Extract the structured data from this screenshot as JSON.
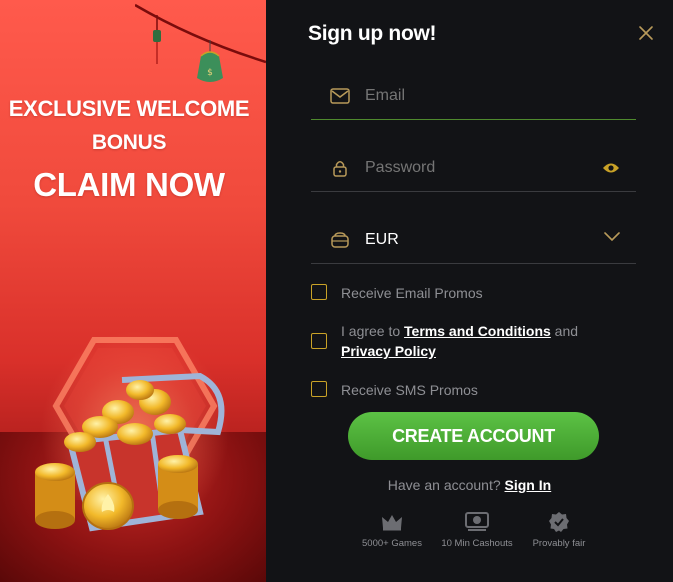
{
  "promo": {
    "line1": "EXCLUSIVE WELCOME",
    "line2": "BONUS",
    "line3": "CLAIM NOW"
  },
  "form": {
    "title": "Sign up now!",
    "email_placeholder": "Email",
    "password_placeholder": "Password",
    "currency_value": "EUR",
    "checkboxes": {
      "email_promos": "Receive Email Promos",
      "agree_prefix": "I agree to ",
      "terms_link": "Terms and Conditions",
      "agree_and": " and ",
      "privacy_link": "Privacy Policy",
      "sms_promos": "Receive SMS Promos"
    },
    "submit_label": "CREATE ACCOUNT",
    "have_account_text": "Have an account? ",
    "sign_in_link": "Sign In"
  },
  "features": [
    {
      "label": "5000+ Games",
      "icon": "crown-icon"
    },
    {
      "label": "10 Min Cashouts",
      "icon": "cashout-icon"
    },
    {
      "label": "Provably fair",
      "icon": "verified-badge-icon"
    }
  ],
  "colors": {
    "accent_green": "#4caf37",
    "checkbox_gold": "#c9a227",
    "icon_gold": "#b89a5a",
    "panel_bg": "#121316",
    "promo_red": "#e43a30"
  }
}
